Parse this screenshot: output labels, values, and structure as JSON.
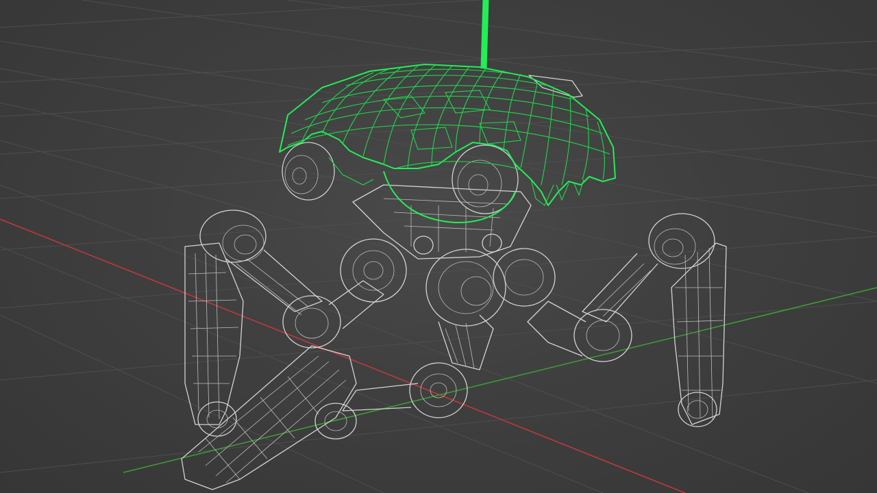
{
  "viewport": {
    "mode": "wireframe",
    "object": "tripod-walker-robot",
    "selected_part": "dome-head",
    "colors": {
      "background": "#3d3d3d",
      "grid": "#4d4d4d",
      "x_axis": "#c0393b",
      "y_axis": "#3e9b35",
      "selection": "#22ee55",
      "wire": "#d4d4d4"
    }
  }
}
